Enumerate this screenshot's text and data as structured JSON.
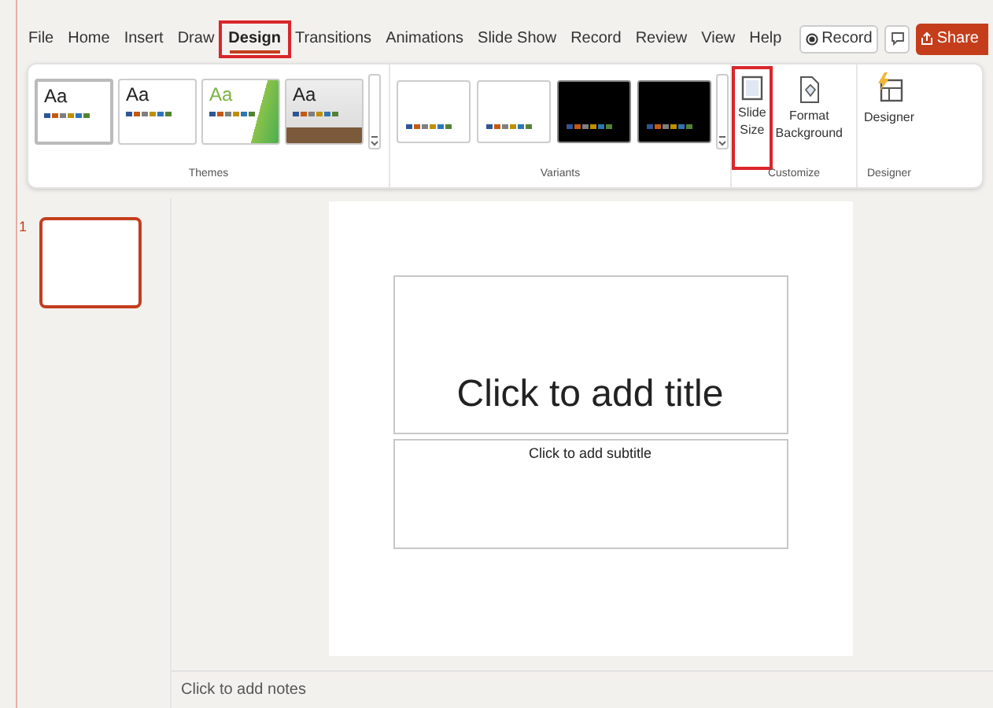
{
  "menu_tabs": [
    {
      "label": "File",
      "selected": false,
      "highlighted": false
    },
    {
      "label": "Home",
      "selected": false,
      "highlighted": false
    },
    {
      "label": "Insert",
      "selected": false,
      "highlighted": false
    },
    {
      "label": "Draw",
      "selected": false,
      "highlighted": false
    },
    {
      "label": "Design",
      "selected": true,
      "highlighted": true
    },
    {
      "label": "Transitions",
      "selected": false,
      "highlighted": false
    },
    {
      "label": "Animations",
      "selected": false,
      "highlighted": false
    },
    {
      "label": "Slide Show",
      "selected": false,
      "highlighted": false
    },
    {
      "label": "Record",
      "selected": false,
      "highlighted": false
    },
    {
      "label": "Review",
      "selected": false,
      "highlighted": false
    },
    {
      "label": "View",
      "selected": false,
      "highlighted": false
    },
    {
      "label": "Help",
      "selected": false,
      "highlighted": false
    }
  ],
  "record_button": "Record",
  "share_button": "Share",
  "themes": {
    "label": "Themes",
    "items": [
      {
        "kind": "office",
        "text": "Aa"
      },
      {
        "kind": "plain",
        "text": "Aa"
      },
      {
        "kind": "green",
        "text": "Aa"
      },
      {
        "kind": "photo",
        "text": "Aa"
      }
    ]
  },
  "variants": {
    "label": "Variants",
    "items": [
      {
        "kind": "light"
      },
      {
        "kind": "light"
      },
      {
        "kind": "dark"
      },
      {
        "kind": "dark"
      }
    ]
  },
  "customize": {
    "label": "Customize",
    "buttons": [
      {
        "kind": "slide-size",
        "label": "Slide Size",
        "highlighted": true
      },
      {
        "kind": "format-background",
        "label": "Format Background",
        "highlighted": false
      }
    ]
  },
  "designer": {
    "label": "Designer",
    "button": "Designer"
  },
  "thumbnails": [
    {
      "number": "1",
      "selected": true
    }
  ],
  "slide": {
    "title_placeholder": "Click to add title",
    "subtitle_placeholder": "Click to add subtitle"
  },
  "notes_placeholder": "Click to add notes"
}
